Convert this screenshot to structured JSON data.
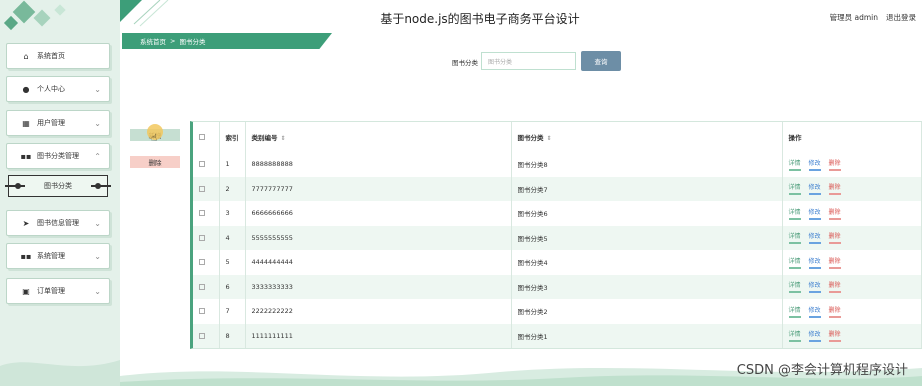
{
  "app": {
    "title": "基于node.js的图书电子商务平台设计",
    "user_label": "管理员 admin",
    "logout_label": "退出登录"
  },
  "breadcrumb": {
    "home": "系统首页",
    "separator": ">",
    "current": "图书分类"
  },
  "search": {
    "label": "图书分类",
    "placeholder": "图书分类",
    "button_label": "查询"
  },
  "actions": {
    "add_label": "新增",
    "delete_label": "删除"
  },
  "sidebar": {
    "items": [
      {
        "label": "系统首页",
        "icon": "home-icon",
        "has_chevron": false
      },
      {
        "label": "个人中心",
        "icon": "user-icon",
        "has_chevron": true
      },
      {
        "label": "用户管理",
        "icon": "grid-icon",
        "has_chevron": true
      },
      {
        "label": "图书分类管理",
        "icon": "apps-icon",
        "has_chevron": true,
        "expanded": true
      },
      {
        "label": "图书信息管理",
        "icon": "send-icon",
        "has_chevron": true
      },
      {
        "label": "系统管理",
        "icon": "apps-icon",
        "has_chevron": true
      },
      {
        "label": "订单管理",
        "icon": "list-icon",
        "has_chevron": true
      }
    ],
    "submenu_active": "图书分类"
  },
  "table": {
    "headers": {
      "index": "索引",
      "code": "类别编号",
      "category": "图书分类",
      "ops": "操作"
    },
    "op_labels": {
      "detail": "详情",
      "edit": "修改",
      "delete": "删除"
    },
    "rows": [
      {
        "index": "1",
        "code": "8888888888",
        "category": "图书分类8"
      },
      {
        "index": "2",
        "code": "7777777777",
        "category": "图书分类7"
      },
      {
        "index": "3",
        "code": "6666666666",
        "category": "图书分类6"
      },
      {
        "index": "4",
        "code": "5555555555",
        "category": "图书分类5"
      },
      {
        "index": "5",
        "code": "4444444444",
        "category": "图书分类4"
      },
      {
        "index": "6",
        "code": "3333333333",
        "category": "图书分类3"
      },
      {
        "index": "7",
        "code": "2222222222",
        "category": "图书分类2"
      },
      {
        "index": "8",
        "code": "1111111111",
        "category": "图书分类1"
      }
    ]
  },
  "watermark": "CSDN @李会计算机程序设计",
  "colors": {
    "accent": "#3d9e79",
    "sidebar_bg": "#e4f1ea",
    "search_btn": "#6d8ea6",
    "delete_red": "#d9534f",
    "edit_blue": "#3d7fcf"
  }
}
